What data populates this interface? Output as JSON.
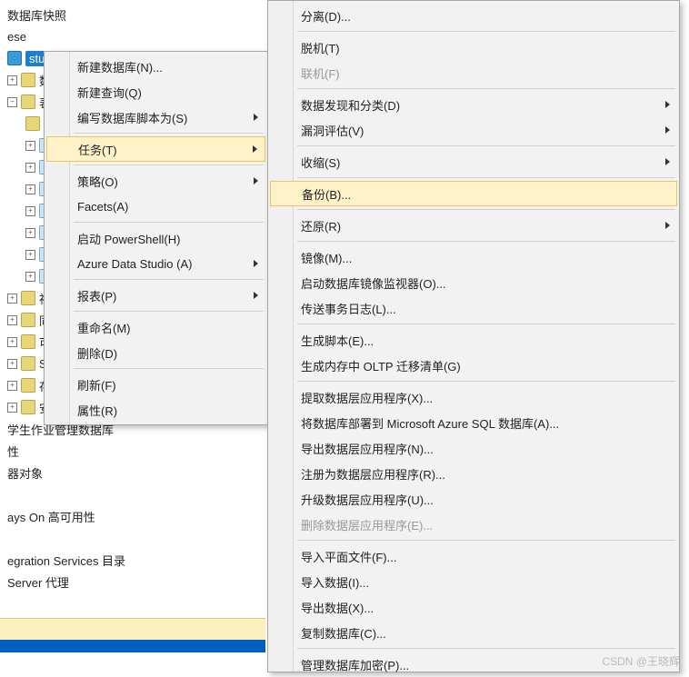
{
  "tree": {
    "items": [
      {
        "label": "数据库快照",
        "icon": "folder",
        "indent": 0
      },
      {
        "label": "ese",
        "icon": "none",
        "indent": 0
      },
      {
        "label": "stud",
        "icon": "blue",
        "indent": 0,
        "selected": true
      },
      {
        "label": "数",
        "icon": "folder",
        "indent": 1
      },
      {
        "label": "表",
        "icon": "folder",
        "indent": 1
      },
      {
        "label": "",
        "icon": "none",
        "indent": 1
      },
      {
        "label": "",
        "icon": "table",
        "indent": 2
      },
      {
        "label": "",
        "icon": "table",
        "indent": 2
      },
      {
        "label": "",
        "icon": "table",
        "indent": 2
      },
      {
        "label": "",
        "icon": "table",
        "indent": 2
      },
      {
        "label": "",
        "icon": "table",
        "indent": 2
      },
      {
        "label": "",
        "icon": "table",
        "indent": 2
      },
      {
        "label": "",
        "icon": "table",
        "indent": 2
      },
      {
        "label": "视",
        "icon": "folder",
        "indent": 1
      },
      {
        "label": "同",
        "icon": "folder",
        "indent": 1
      },
      {
        "label": "可",
        "icon": "folder",
        "indent": 1
      },
      {
        "label": "Se",
        "icon": "folder",
        "indent": 1
      },
      {
        "label": "存",
        "icon": "folder",
        "indent": 1
      },
      {
        "label": "安全性",
        "icon": "folder",
        "indent": 1
      },
      {
        "label": "学生作业管理数据库",
        "icon": "folder",
        "indent": 0
      },
      {
        "label": "性",
        "icon": "folder",
        "indent": 0
      },
      {
        "label": "器对象",
        "icon": "folder",
        "indent": 0
      },
      {
        "label": "",
        "icon": "folder",
        "indent": 0
      },
      {
        "label": "ays On 高可用性",
        "icon": "folder",
        "indent": 0
      },
      {
        "label": "",
        "icon": "folder",
        "indent": 0
      },
      {
        "label": "egration Services 目录",
        "icon": "folder",
        "indent": 0
      },
      {
        "label": "  Server 代理",
        "icon": "folder",
        "indent": 0
      }
    ]
  },
  "menu1": {
    "groups": [
      [
        {
          "label": "新建数据库(N)..."
        },
        {
          "label": "新建查询(Q)"
        },
        {
          "label": "编写数据库脚本为(S)",
          "arrow": true
        }
      ],
      [
        {
          "label": "任务(T)",
          "arrow": true,
          "highlighted": true
        }
      ],
      [
        {
          "label": "策略(O)",
          "arrow": true
        },
        {
          "label": "Facets(A)"
        }
      ],
      [
        {
          "label": "启动 PowerShell(H)"
        },
        {
          "label": "Azure Data Studio (A)",
          "arrow": true
        }
      ],
      [
        {
          "label": "报表(P)",
          "arrow": true
        }
      ],
      [
        {
          "label": "重命名(M)"
        },
        {
          "label": "删除(D)"
        }
      ],
      [
        {
          "label": "刷新(F)"
        },
        {
          "label": "属性(R)"
        }
      ]
    ]
  },
  "menu2": {
    "groups": [
      [
        {
          "label": "分离(D)..."
        }
      ],
      [
        {
          "label": "脱机(T)"
        },
        {
          "label": "联机(F)",
          "disabled": true
        }
      ],
      [
        {
          "label": "数据发现和分类(D)",
          "arrow": true
        },
        {
          "label": "漏洞评估(V)",
          "arrow": true
        }
      ],
      [
        {
          "label": "收缩(S)",
          "arrow": true
        }
      ],
      [
        {
          "label": "备份(B)...",
          "highlighted": true
        }
      ],
      [
        {
          "label": "还原(R)",
          "arrow": true
        }
      ],
      [
        {
          "label": "镜像(M)..."
        },
        {
          "label": "启动数据库镜像监视器(O)..."
        },
        {
          "label": "传送事务日志(L)..."
        }
      ],
      [
        {
          "label": "生成脚本(E)..."
        },
        {
          "label": "生成内存中 OLTP 迁移清单(G)"
        }
      ],
      [
        {
          "label": "提取数据层应用程序(X)..."
        },
        {
          "label": "将数据库部署到 Microsoft Azure SQL 数据库(A)..."
        },
        {
          "label": "导出数据层应用程序(N)..."
        },
        {
          "label": "注册为数据层应用程序(R)..."
        },
        {
          "label": "升级数据层应用程序(U)..."
        },
        {
          "label": "删除数据层应用程序(E)...",
          "disabled": true
        }
      ],
      [
        {
          "label": "导入平面文件(F)..."
        },
        {
          "label": "导入数据(I)..."
        },
        {
          "label": "导出数据(X)..."
        },
        {
          "label": "复制数据库(C)..."
        }
      ],
      [
        {
          "label": "管理数据库加密(P)..."
        }
      ]
    ]
  },
  "watermark": "CSDN @王晓辉"
}
